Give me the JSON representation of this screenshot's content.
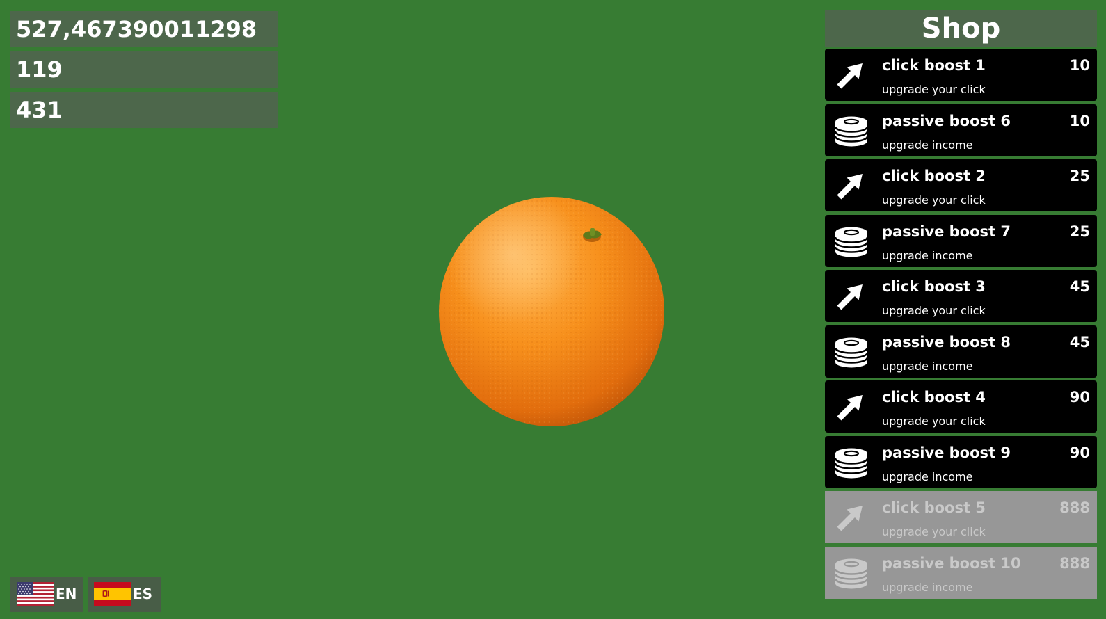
{
  "theme": {
    "background": "#377c33",
    "item_background": "#000000",
    "item_disabled_background": "#979797",
    "text_color": "#ffffff"
  },
  "stats": {
    "total": "527,467390011298",
    "per_click": "119",
    "per_second": "431"
  },
  "shop": {
    "title": "Shop",
    "items": [
      {
        "name": "click boost 1",
        "desc": "upgrade your click",
        "price": "10",
        "icon": "arrow-icon",
        "available": true
      },
      {
        "name": "passive boost 6",
        "desc": "upgrade income",
        "price": "10",
        "icon": "coins-icon",
        "available": true
      },
      {
        "name": "click boost 2",
        "desc": "upgrade your click",
        "price": "25",
        "icon": "arrow-icon",
        "available": true
      },
      {
        "name": "passive boost 7",
        "desc": "upgrade income",
        "price": "25",
        "icon": "coins-icon",
        "available": true
      },
      {
        "name": "click boost 3",
        "desc": "upgrade your click",
        "price": "45",
        "icon": "arrow-icon",
        "available": true
      },
      {
        "name": "passive boost 8",
        "desc": "upgrade income",
        "price": "45",
        "icon": "coins-icon",
        "available": true
      },
      {
        "name": "click boost 4",
        "desc": "upgrade your click",
        "price": "90",
        "icon": "arrow-icon",
        "available": true
      },
      {
        "name": "passive boost 9",
        "desc": "upgrade income",
        "price": "90",
        "icon": "coins-icon",
        "available": true
      },
      {
        "name": "click boost 5",
        "desc": "upgrade your click",
        "price": "888",
        "icon": "arrow-icon",
        "available": false
      },
      {
        "name": "passive boost 10",
        "desc": "upgrade income",
        "price": "888",
        "icon": "coins-icon",
        "available": false
      }
    ]
  },
  "languages": [
    {
      "code": "EN",
      "flag": "us-flag-icon"
    },
    {
      "code": "ES",
      "flag": "spain-flag-icon"
    }
  ]
}
